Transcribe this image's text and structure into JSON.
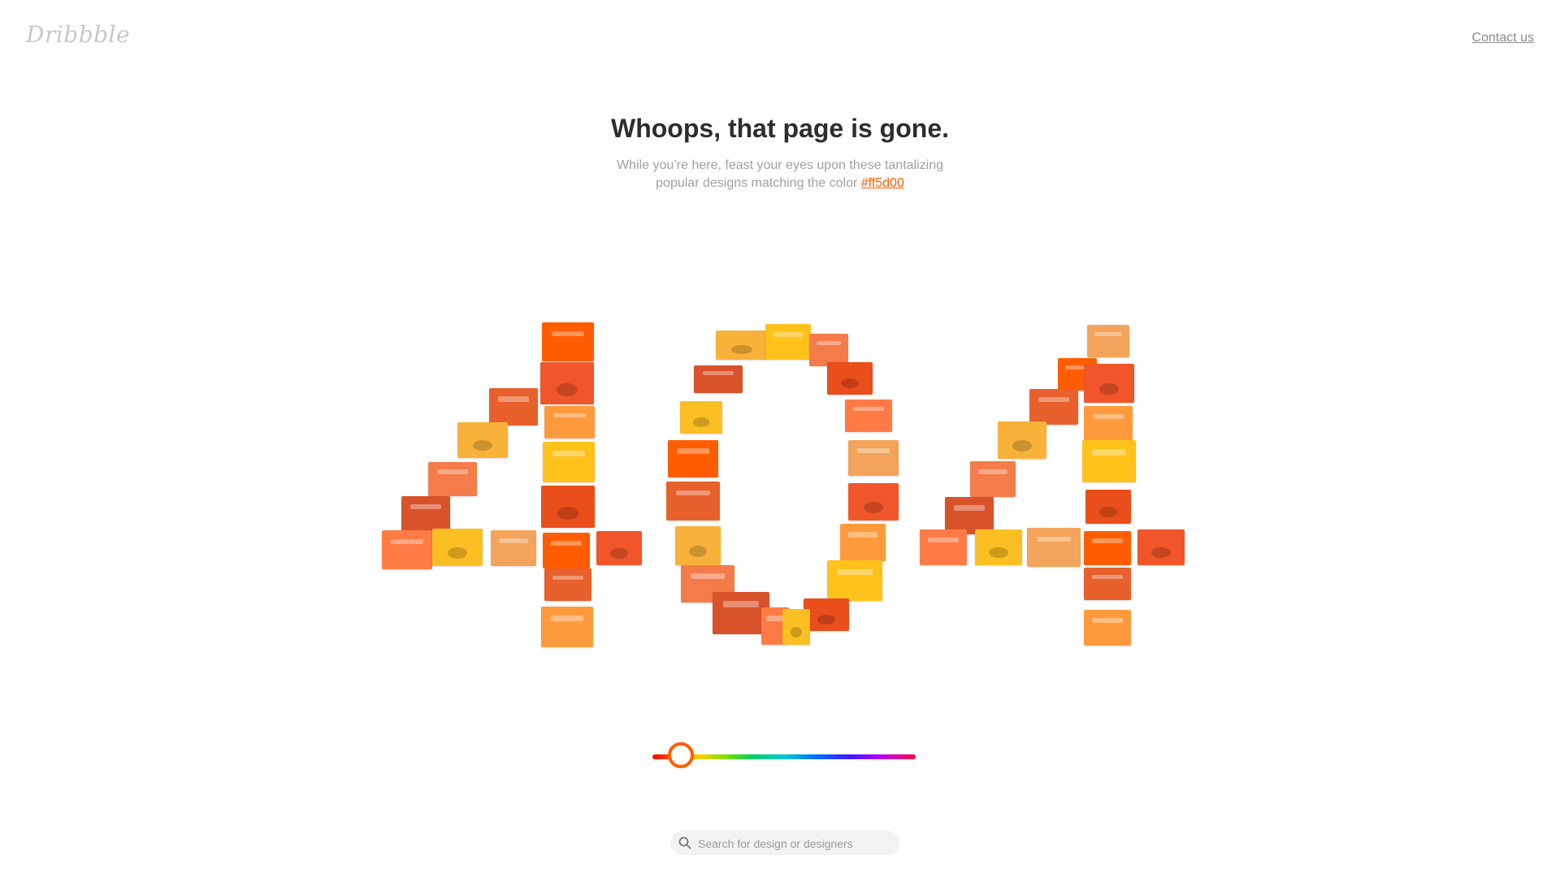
{
  "header": {
    "logo_text": "Dribbble",
    "contact_label": "Contact us"
  },
  "hero": {
    "title": "Whoops, that page is gone.",
    "subtitle_line1": "While you’re here, feast your eyes upon these tantalizing",
    "subtitle_line2": "popular designs matching the color",
    "color_link": "#ff5d00"
  },
  "colors": {
    "accent": "#ff5d00",
    "tiles": [
      "#ff5d00",
      "#f0562a",
      "#e8602c",
      "#ff9a3c",
      "#f8b23a",
      "#ffc21a",
      "#f47b4a",
      "#e94e1b",
      "#d9532a",
      "#ff7a45",
      "#fbbf24",
      "#f3a35a"
    ]
  },
  "color_slider": {
    "value_hex": "#ff5d00",
    "position_fraction": 0.08
  },
  "search": {
    "placeholder": "Search for design or designers",
    "value": "",
    "icon": "search-icon"
  },
  "shots_grid": {
    "shape": "404",
    "tile_count": 72
  }
}
